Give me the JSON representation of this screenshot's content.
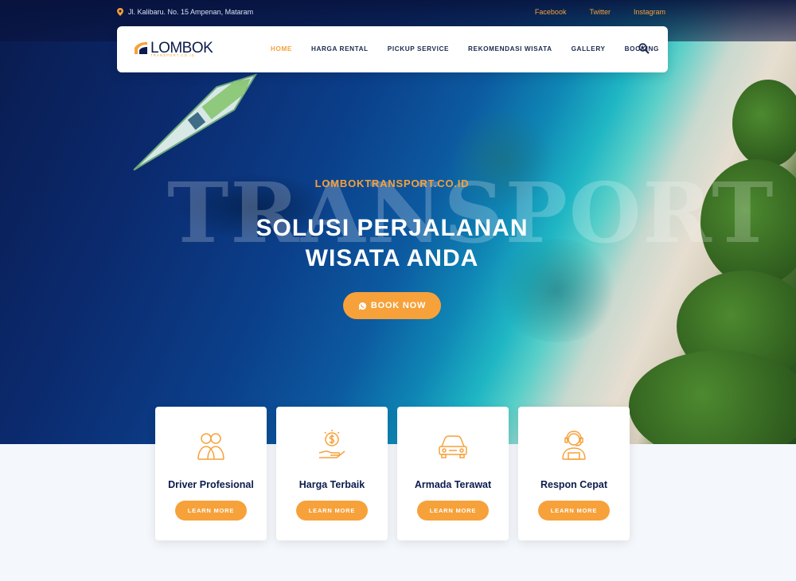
{
  "topbar": {
    "address": "Jl. Kalibaru. No. 15 Ampenan, Mataram",
    "social": [
      "Facebook",
      "Twitter",
      "Instagram"
    ]
  },
  "brand": {
    "name": "LOMBOK",
    "tagline": "TRANSPORT.CO.ID"
  },
  "nav": {
    "items": [
      "HOME",
      "HARGA RENTAL",
      "PICKUP SERVICE",
      "REKOMENDASI WISATA",
      "GALLERY",
      "BOOKING"
    ],
    "active": "HOME"
  },
  "hero": {
    "watermark": "TRANSPORT",
    "kicker": "LOMBOKTRANSPORT.CO.ID",
    "title_line1": "SOLUSI PERJALANAN",
    "title_line2": "WISATA ANDA",
    "button": "BOOK NOW"
  },
  "features": [
    {
      "title": "Driver Profesional",
      "icon": "drivers-icon",
      "button": "LEARN MORE"
    },
    {
      "title": "Harga Terbaik",
      "icon": "money-hand-icon",
      "button": "LEARN MORE"
    },
    {
      "title": "Armada Terawat",
      "icon": "car-icon",
      "button": "LEARN MORE"
    },
    {
      "title": "Respon Cepat",
      "icon": "support-agent-icon",
      "button": "LEARN MORE"
    }
  ],
  "colors": {
    "accent": "#f7a13a",
    "navy": "#0b1b4d",
    "bg": "#f4f7fb"
  }
}
